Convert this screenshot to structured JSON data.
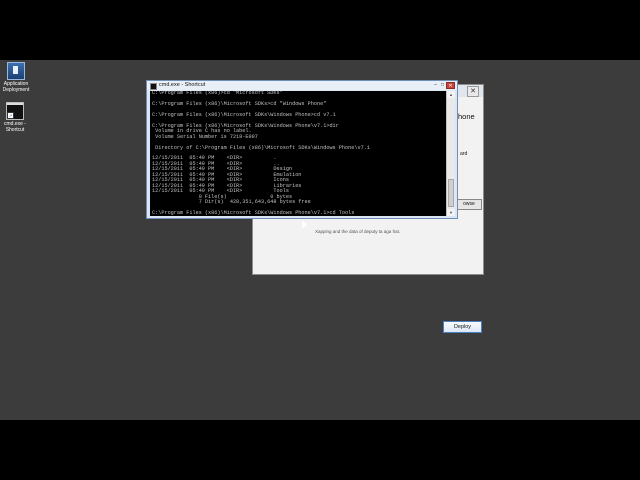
{
  "desktop": {
    "icons": [
      {
        "label": "Application Deployment",
        "icon": "application-deployment-icon"
      },
      {
        "label": "cmd.exe - Shortcut",
        "icon": "cmd-icon"
      }
    ]
  },
  "deploy_window": {
    "fragment_phone": "hone",
    "fragment_ard": "ard",
    "fragment_browse": "owse",
    "status": "Xapping and the data of deputy ta aga hat.",
    "deploy_label": "Deploy",
    "close_glyph": "✕"
  },
  "cmd_window": {
    "title": "cmd.exe - Shortcut",
    "lines": [
      "C:\\Program Files (x86)>cd \"Microsoft SDKs\"",
      "",
      "C:\\Program Files (x86)\\Microsoft SDKs>cd \"Windows Phone\"",
      "",
      "C:\\Program Files (x86)\\Microsoft SDKs\\Windows Phone>cd v7.1",
      "",
      "C:\\Program Files (x86)\\Microsoft SDKs\\Windows Phone\\v7.1>dir",
      " Volume in drive C has no label.",
      " Volume Serial Number is 7218-E007",
      "",
      " Directory of C:\\Program Files (x86)\\Microsoft SDKs\\Windows Phone\\v7.1",
      "",
      "12/15/2011  05:49 PM    <DIR>          .",
      "12/15/2011  05:49 PM    <DIR>          ..",
      "12/15/2011  05:49 PM    <DIR>          Design",
      "12/15/2011  05:49 PM    <DIR>          Emulation",
      "12/15/2011  05:49 PM    <DIR>          Icons",
      "12/15/2011  05:49 PM    <DIR>          Libraries",
      "12/15/2011  05:49 PM    <DIR>          Tools",
      "               0 File(s)              0 bytes",
      "               7 Dir(s)  428,351,643,648 bytes free",
      "",
      "C:\\Program Files (x86)\\Microsoft SDKs\\Windows Phone\\v7.1>cd Tools",
      "",
      "C:\\Program Files (x86)\\Microsoft SDKs\\Windows Phone\\v7.1\\Tools>"
    ]
  }
}
